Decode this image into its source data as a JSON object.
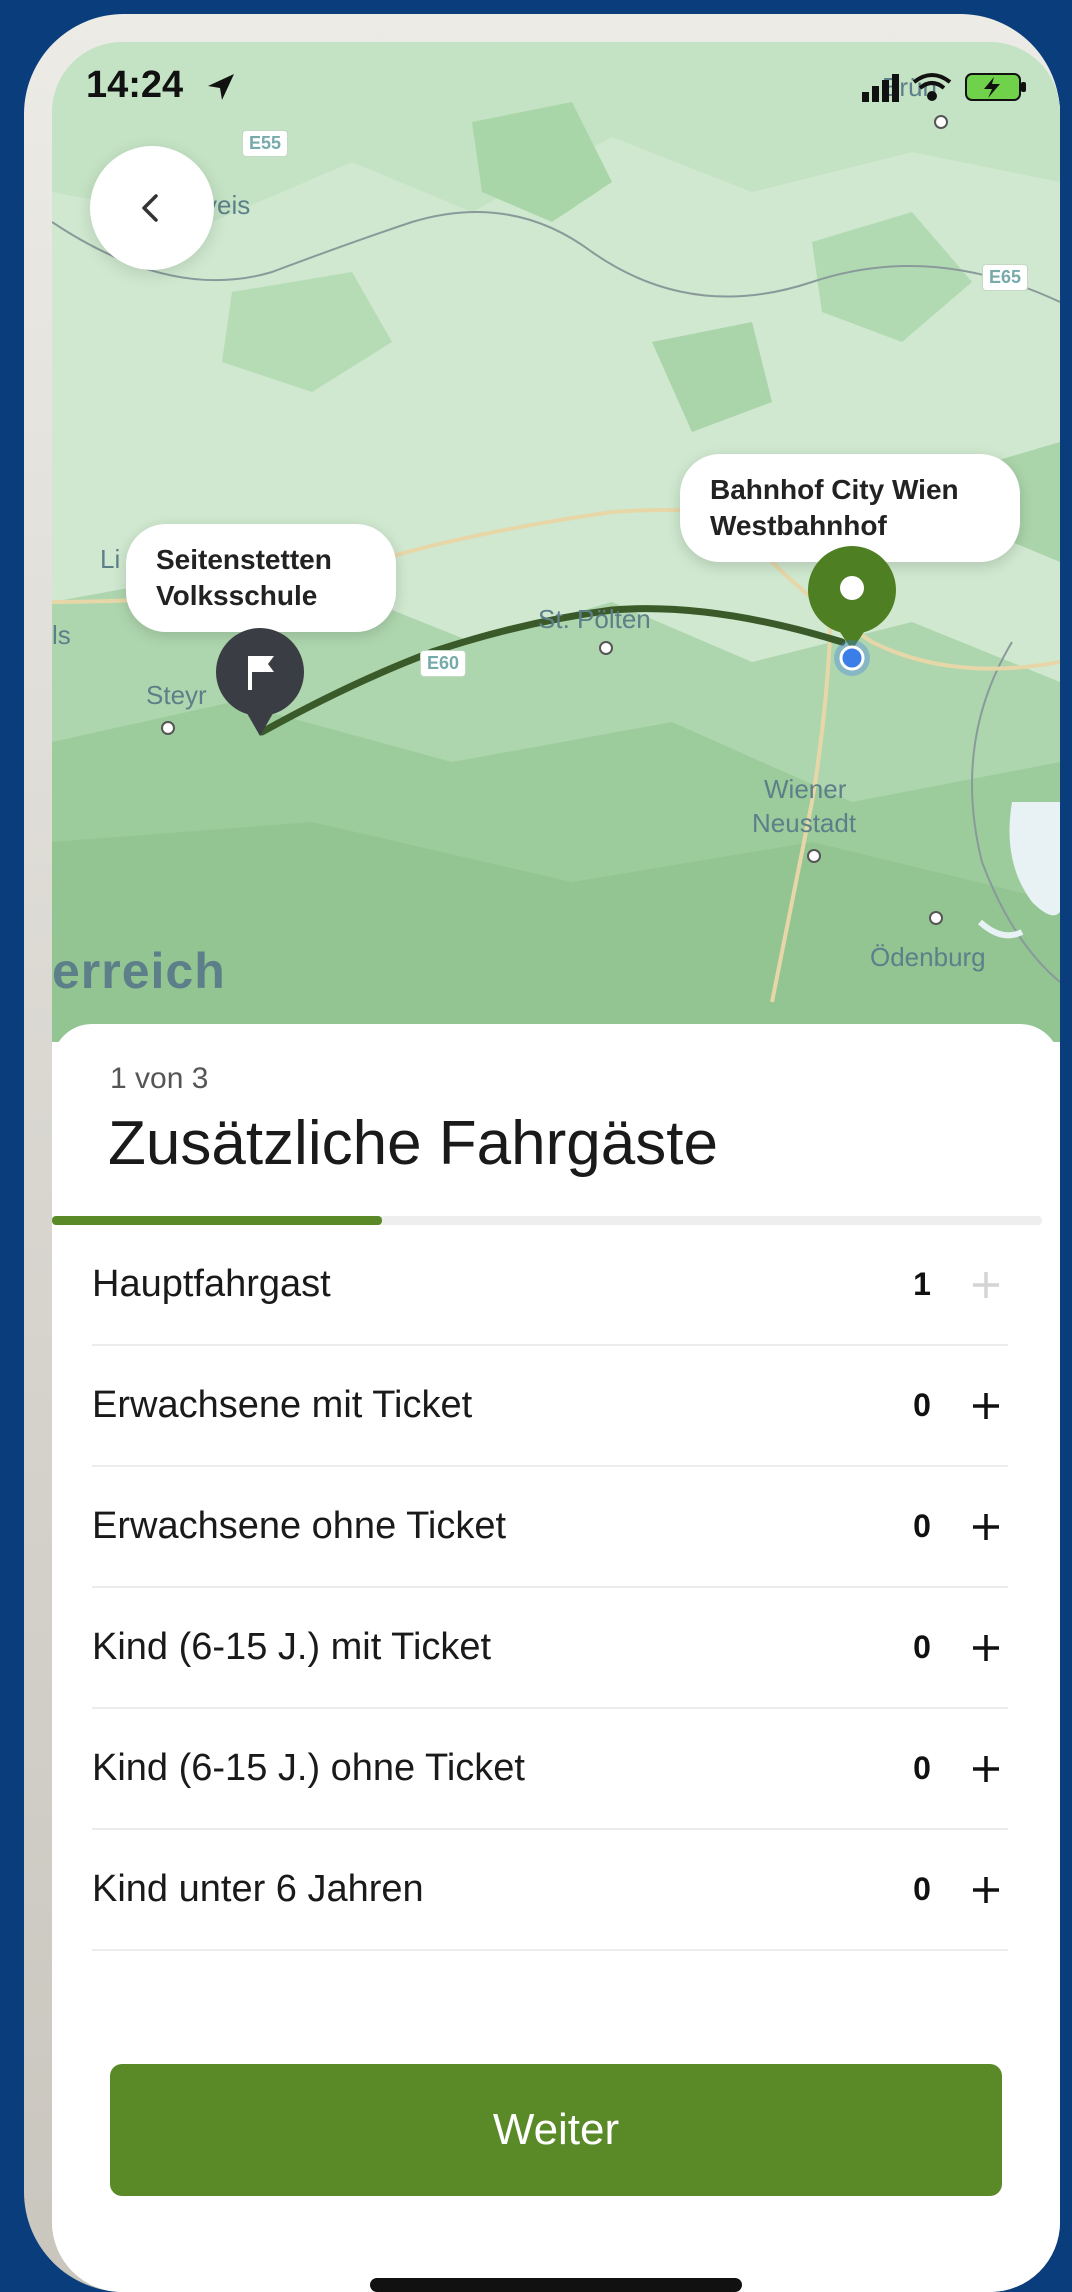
{
  "status": {
    "time": "14:24"
  },
  "map": {
    "start_callout": {
      "line1": "Seitenstetten",
      "line2": "Volksschule"
    },
    "dest_callout": {
      "line1": "Bahnhof City Wien",
      "line2": "Westbahnhof"
    },
    "labels": {
      "budweis": "veis",
      "steyr": "Steyr",
      "st_poelten": "St. Pölten",
      "wiener_neustadt_1": "Wiener",
      "wiener_neustadt_2": "Neustadt",
      "odenburg": "Ödenburg",
      "linz_frag": "Li",
      "wels_frag": "ls",
      "country": "erreich",
      "brno_frag": "Brün"
    },
    "road_shields": {
      "e55": "E55",
      "e65": "E65",
      "e60": "E60"
    }
  },
  "sheet": {
    "step": "1 von 3",
    "title": "Zusätzliche Fahrgäste",
    "progress_fraction": 0.333,
    "rows": [
      {
        "label": "Hauptfahrgast",
        "count": "1",
        "plus_enabled": false
      },
      {
        "label": "Erwachsene mit Ticket",
        "count": "0",
        "plus_enabled": true
      },
      {
        "label": "Erwachsene ohne Ticket",
        "count": "0",
        "plus_enabled": true
      },
      {
        "label": "Kind (6-15 J.) mit Ticket",
        "count": "0",
        "plus_enabled": true
      },
      {
        "label": "Kind (6-15 J.) ohne Ticket",
        "count": "0",
        "plus_enabled": true
      },
      {
        "label": "Kind unter 6 Jahren",
        "count": "0",
        "plus_enabled": true
      }
    ],
    "continue_label": "Weiter"
  },
  "colors": {
    "accent_green": "#5a8a28",
    "map_green": "#cfe8cf",
    "route": "#3b5a2a",
    "dest_pin": "#4f7f23",
    "start_pin": "#3a3d44",
    "location_dot": "#3b7ee8",
    "background": "#0a3d7c"
  },
  "icons": {
    "back": "chevron-left-icon",
    "start_pin": "flag-pin-icon",
    "dest_pin": "location-pin-icon",
    "plus": "plus-icon"
  }
}
